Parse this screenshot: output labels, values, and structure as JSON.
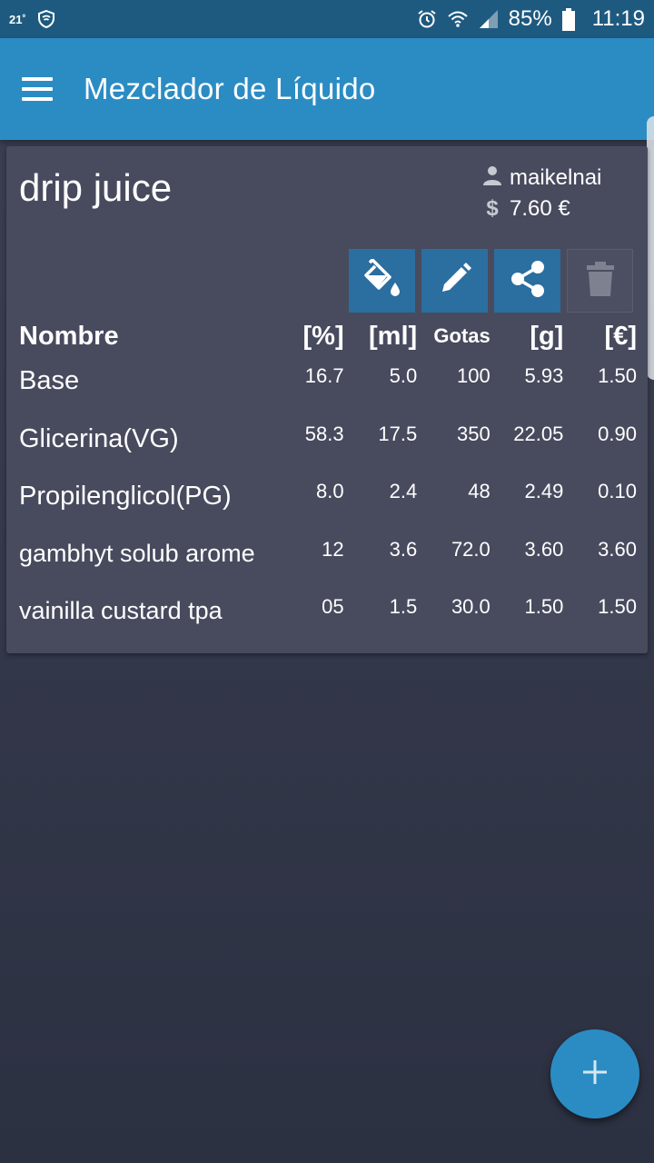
{
  "status_bar": {
    "temperature": "21˚",
    "battery_percent": "85%",
    "time": "11:19"
  },
  "app_bar": {
    "title": "Mezclador de Líquido",
    "menu_icon": "hamburger-menu-icon"
  },
  "recipe": {
    "name": "drip juice",
    "author": "maikelnai",
    "cost": "7.60 €",
    "author_icon": "person-icon",
    "cost_icon": "dollar-icon"
  },
  "actions": [
    {
      "name": "fill-action-button",
      "icon": "paint-bucket-icon"
    },
    {
      "name": "edit-action-button",
      "icon": "pencil-icon"
    },
    {
      "name": "share-action-button",
      "icon": "share-icon"
    },
    {
      "name": "delete-action-button",
      "icon": "trash-icon"
    }
  ],
  "table": {
    "headers": [
      "Nombre",
      "[%]",
      "[ml]",
      "Gotas",
      "[g]",
      "[€]"
    ],
    "rows": [
      [
        "Base",
        "16.7",
        "5.0",
        "100",
        "5.93",
        "1.50"
      ],
      [
        "Glicerina(VG)",
        "58.3",
        "17.5",
        "350",
        "22.05",
        "0.90"
      ],
      [
        "Propilenglicol(PG)",
        "8.0",
        "2.4",
        "48",
        "2.49",
        "0.10"
      ],
      [
        "gambhyt solub arome",
        "12",
        "3.6",
        "72.0",
        "3.60",
        "3.60"
      ],
      [
        "vainilla custard tpa",
        "05",
        "1.5",
        "30.0",
        "1.50",
        "1.50"
      ]
    ]
  },
  "fab": {
    "label": "+",
    "icon": "plus-icon"
  },
  "colors": {
    "status_bar": "#1e5a80",
    "app_bar": "#2b8cc4",
    "card": "#484b5e",
    "action_button": "#2b6ea0",
    "background": "#2f3445"
  }
}
